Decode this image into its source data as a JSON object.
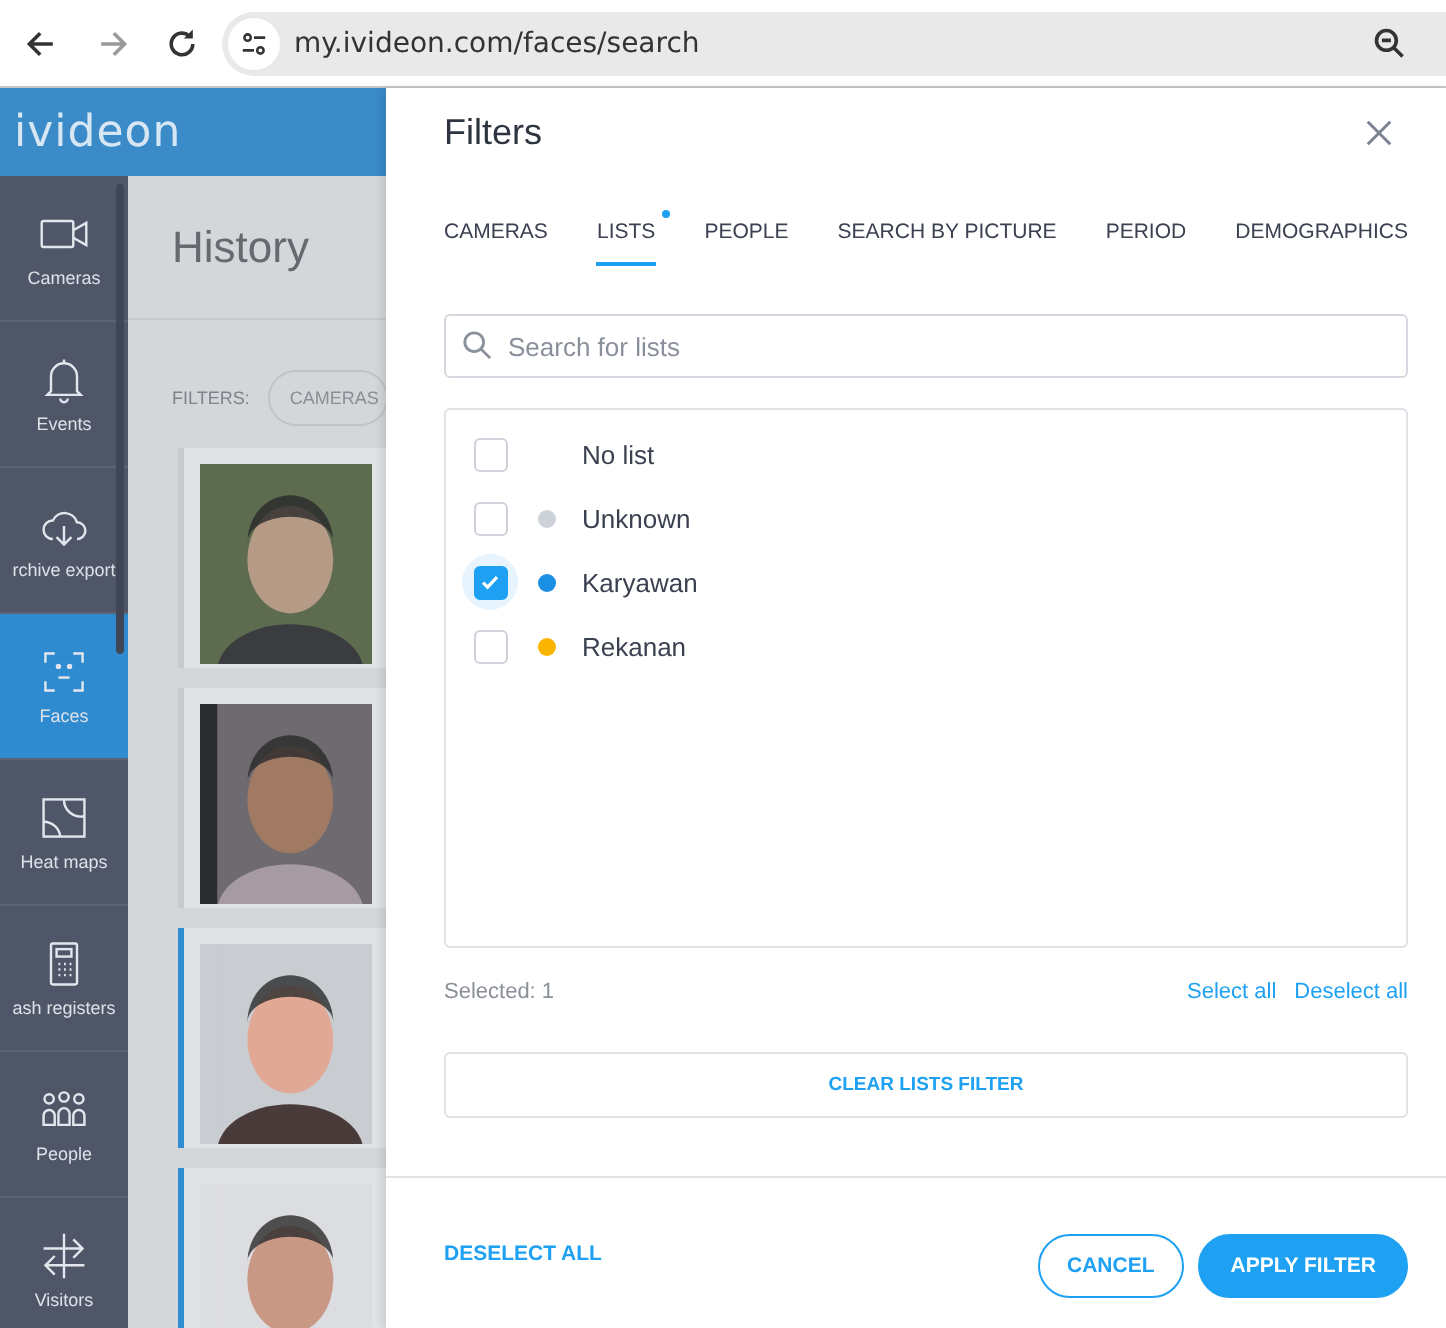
{
  "browser": {
    "url": "my.ivideon.com/faces/search",
    "forward_enabled": false
  },
  "app": {
    "logo": "ivideon",
    "nav": [
      {
        "label": "Cameras",
        "selected": false
      },
      {
        "label": "Events",
        "selected": false
      },
      {
        "label": "rchive export",
        "selected": false
      },
      {
        "label": "Faces",
        "selected": true
      },
      {
        "label": "Heat maps",
        "selected": false
      },
      {
        "label": "ash registers",
        "selected": false
      },
      {
        "label": "People",
        "selected": false
      },
      {
        "label": "Visitors",
        "selected": false
      }
    ],
    "page_title": "History",
    "filters_label": "FILTERS:",
    "filter_chip": "CAMERAS",
    "results": [
      {
        "kind": "picture",
        "highlighted": false
      },
      {
        "kind": "picture",
        "highlighted": false
      },
      {
        "kind": "picture",
        "highlighted": true
      },
      {
        "kind": "picture",
        "highlighted": true
      }
    ]
  },
  "modal": {
    "title": "Filters",
    "tabs": [
      {
        "label": "CAMERAS",
        "selected": false,
        "dot": false
      },
      {
        "label": "LISTS",
        "selected": true,
        "dot": true
      },
      {
        "label": "PEOPLE",
        "selected": false,
        "dot": false
      },
      {
        "label": "SEARCH BY PICTURE",
        "selected": false,
        "dot": false
      },
      {
        "label": "PERIOD",
        "selected": false,
        "dot": false
      },
      {
        "label": "DEMOGRAPHICS",
        "selected": false,
        "dot": false
      }
    ],
    "search": {
      "placeholder": "Search for lists"
    },
    "lists": [
      {
        "label": "No list",
        "checked": false
      },
      {
        "label": "Unknown",
        "checked": false,
        "color": "#cdd1d8"
      },
      {
        "label": "Karyawan",
        "checked": true,
        "color": "#1a8fe3"
      },
      {
        "label": "Rekanan",
        "checked": false,
        "color": "#fbb400"
      }
    ],
    "selected_count": "Selected: 1",
    "select_all": "Select all",
    "deselect_all_link": "Deselect all",
    "clear_button": "CLEAR LISTS FILTER",
    "deselect_all_button": "DESELECT ALL",
    "cancel_button": "CANCEL",
    "apply_button": "APPLY FILTER"
  }
}
